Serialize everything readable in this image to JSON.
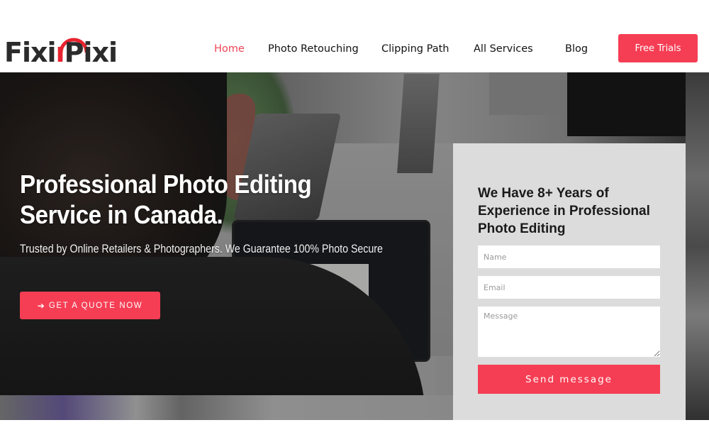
{
  "brand": {
    "logo_part1": "Fixi",
    "logo_part2": "P",
    "logo_part3": "ixi",
    "accent_color": "#f53e54",
    "logo_red": "#e8232f"
  },
  "nav": {
    "items": [
      {
        "label": "Home",
        "active": true
      },
      {
        "label": "Photo Retouching",
        "active": false
      },
      {
        "label": "Clipping Path",
        "active": false
      },
      {
        "label": "All Services",
        "active": false
      },
      {
        "label": "Blog",
        "active": false
      }
    ],
    "cta_label": "Free Trials"
  },
  "hero": {
    "title": "Professional Photo Editing Service in Canada.",
    "subtitle": "Trusted by Online Retailers & Photographers. We Guarantee 100% Photo Secure",
    "cta_icon": "arrow-right-icon",
    "cta_label": "GET A QUOTE NOW"
  },
  "contact_form": {
    "heading": "We Have 8+ Years of Experience in Professional Photo Editing",
    "name_placeholder": "Name",
    "email_placeholder": "Email",
    "message_placeholder": "Message",
    "submit_label": "Send message"
  }
}
